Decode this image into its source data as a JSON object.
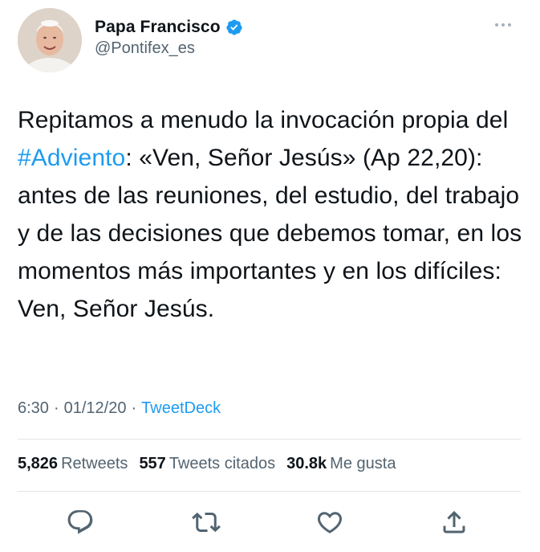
{
  "user": {
    "display_name": "Papa Francisco",
    "handle": "@Pontifex_es",
    "verified": true
  },
  "tweet": {
    "text_before": "Repitamos a menudo la invocación propia del ",
    "hashtag": "#Adviento",
    "text_after": ": «Ven, Señor Jesús» (Ap 22,20): antes de las reuniones, del estudio, del trabajo y de las decisiones que debemos tomar, en los momentos más importantes y en los difíciles: Ven, Señor Jesús."
  },
  "meta": {
    "time": "6:30",
    "separator1": "·",
    "date": "01/12/20",
    "separator2": "·",
    "source": "TweetDeck"
  },
  "stats": {
    "retweets_count": "5,826",
    "retweets_label": "Retweets",
    "quotes_count": "557",
    "quotes_label": "Tweets citados",
    "likes_count": "30.8k",
    "likes_label": "Me gusta"
  },
  "actions": {
    "reply_icon": "reply-icon",
    "retweet_icon": "retweet-icon",
    "like_icon": "heart-icon",
    "share_icon": "share-icon"
  },
  "colors": {
    "accent": "#1d9bf0",
    "text": "#0f1419",
    "secondary": "#536471",
    "divider": "#e1e5e8",
    "icon": "#536471"
  }
}
